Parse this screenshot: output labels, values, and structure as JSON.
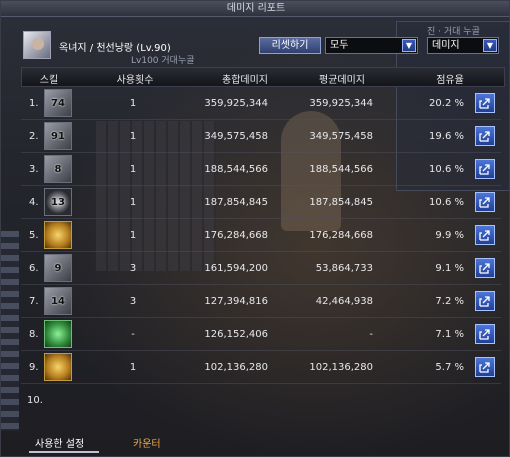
{
  "window": {
    "title": "데미지 리포트"
  },
  "character": {
    "name": "옥녀지 / 천선낭랑 (Lv.90)",
    "subtag": "Lv100 거대누골"
  },
  "controls": {
    "reset_label": "리셋하기",
    "target_select": "모두",
    "type_select": "데미지",
    "side_hint": "진 · 거대 누골"
  },
  "table": {
    "headers": {
      "skill": "스킬",
      "uses": "사용횟수",
      "total": "총합데미지",
      "avg": "평균데미지",
      "share": "점유율"
    },
    "rows": [
      {
        "num": "1.",
        "level": "74",
        "icon": "gray",
        "uses": "1",
        "total": "359,925,344",
        "avg": "359,925,344",
        "share": "20.2 %"
      },
      {
        "num": "2.",
        "level": "91",
        "icon": "gray",
        "uses": "1",
        "total": "349,575,458",
        "avg": "349,575,458",
        "share": "19.6 %"
      },
      {
        "num": "3.",
        "level": "8",
        "icon": "gray",
        "uses": "1",
        "total": "188,544,566",
        "avg": "188,544,566",
        "share": "10.6 %"
      },
      {
        "num": "4.",
        "level": "13",
        "icon": "dark",
        "uses": "1",
        "total": "187,854,845",
        "avg": "187,854,845",
        "share": "10.6 %"
      },
      {
        "num": "5.",
        "level": "",
        "icon": "gold",
        "uses": "1",
        "total": "176,284,668",
        "avg": "176,284,668",
        "share": "9.9 %"
      },
      {
        "num": "6.",
        "level": "9",
        "icon": "gray",
        "uses": "3",
        "total": "161,594,200",
        "avg": "53,864,733",
        "share": "9.1 %"
      },
      {
        "num": "7.",
        "level": "14",
        "icon": "gray",
        "uses": "3",
        "total": "127,394,816",
        "avg": "42,464,938",
        "share": "7.2 %"
      },
      {
        "num": "8.",
        "level": "",
        "icon": "green",
        "uses": "-",
        "total": "126,152,406",
        "avg": "-",
        "share": "7.1 %"
      },
      {
        "num": "9.",
        "level": "",
        "icon": "gold",
        "uses": "1",
        "total": "102,136,280",
        "avg": "102,136,280",
        "share": "5.7 %"
      },
      {
        "num": "10.",
        "level": "",
        "icon": "none",
        "uses": "",
        "total": "",
        "avg": "",
        "share": ""
      }
    ]
  },
  "tabs": {
    "used_settings": "사용한 설정",
    "counter": "카운터"
  },
  "colors": {
    "accent_blue": "#2f52b8",
    "tab_orange": "#f2a64a"
  }
}
